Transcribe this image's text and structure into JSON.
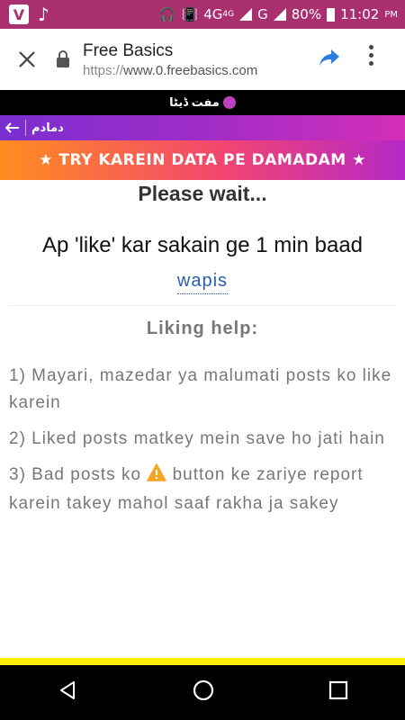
{
  "status_bar": {
    "network": "4G",
    "network_small": "4G",
    "carrier_letter": "G",
    "battery": "80%",
    "time": "11:02",
    "time_suffix": "PM"
  },
  "browser": {
    "title": "Free Basics",
    "url_scheme": "https://",
    "url_host": "www.0.freebasics.com"
  },
  "brand": {
    "name": "مفت ڈیٹا"
  },
  "nav": {
    "label": "دمادم"
  },
  "promo": {
    "text": "★ TRY KAREIN DATA PE DAMADAM ★"
  },
  "main": {
    "please_wait": "Please wait...",
    "like_message": "Ap 'like' kar sakain ge 1 min baad",
    "wapis_link": "wapis",
    "help_title": "Liking help:",
    "help_items": [
      "1) Mayari, mazedar ya malumati posts ko like karein",
      "2) Liked posts matkey mein save ho jati hain"
    ],
    "help_item3_before": "3) Bad posts ko",
    "help_item3_after": "button ke zariye report karein takey mahol saaf rakha ja sakey"
  },
  "colors": {
    "status_bar": "#aa2f6f",
    "link": "#2a5db0",
    "warning": "#f5a623"
  }
}
